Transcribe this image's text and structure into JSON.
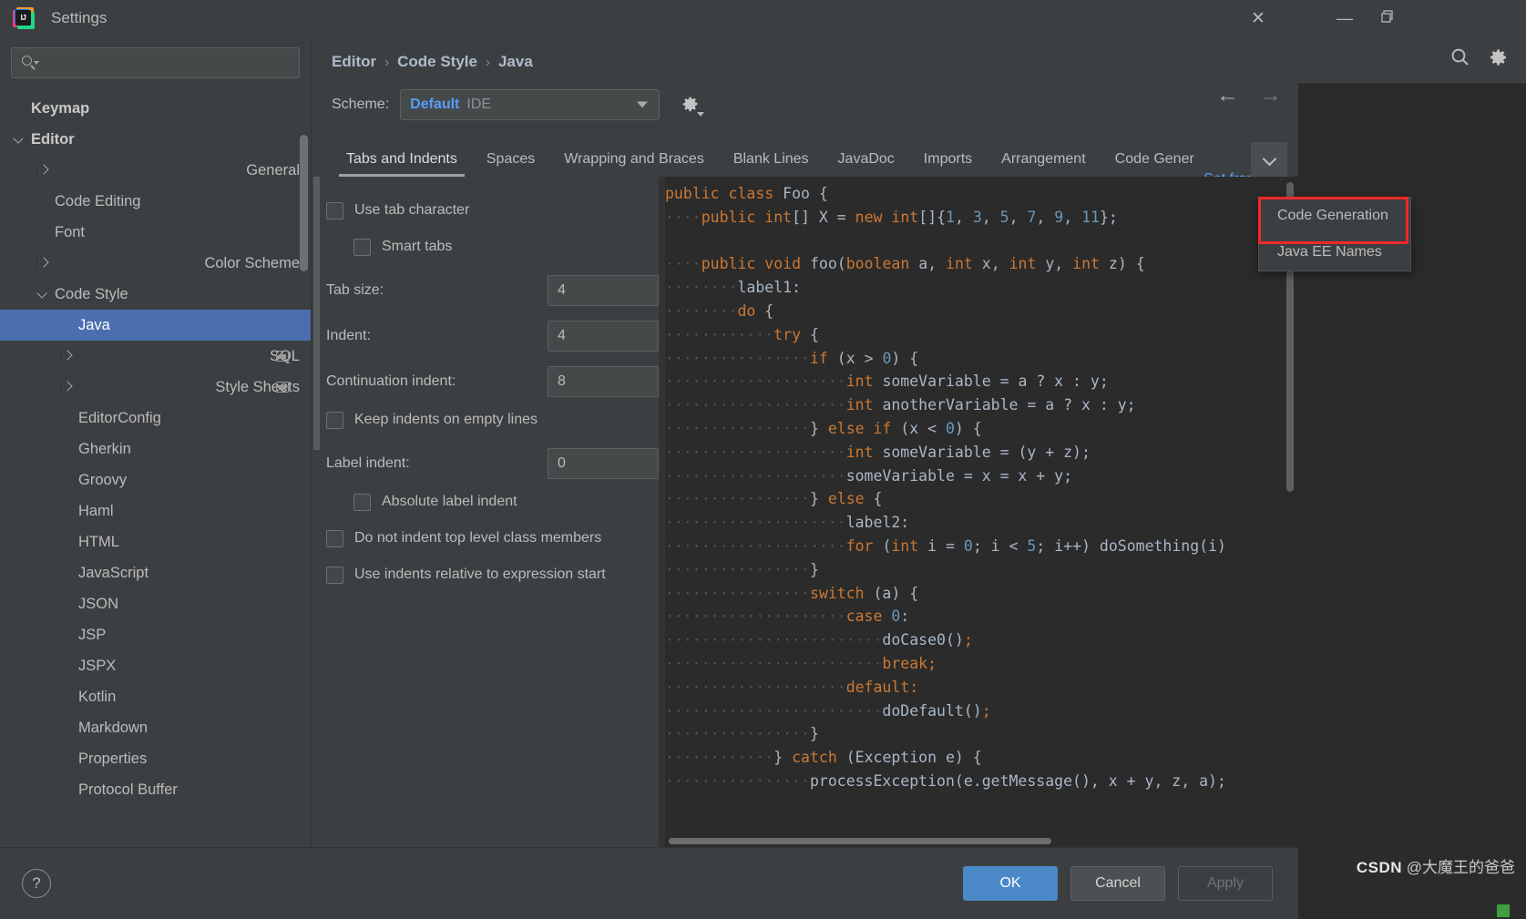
{
  "window": {
    "title": "Settings",
    "app_icon": "intellij-idea-icon",
    "close_label": "✕",
    "minimize_label": "—",
    "restore_label": "❐"
  },
  "ide": {
    "search_icon": "search-icon",
    "settings_icon": "gear-icon"
  },
  "sidebar": {
    "search_placeholder": "",
    "items": [
      {
        "label": "Keymap",
        "indent": 0,
        "chevron": "none",
        "bold": true,
        "selected": false,
        "badge": false
      },
      {
        "label": "Editor",
        "indent": 0,
        "chevron": "down",
        "bold": true,
        "selected": false,
        "badge": false
      },
      {
        "label": "General",
        "indent": 1,
        "chevron": "right",
        "bold": false,
        "selected": false,
        "badge": false
      },
      {
        "label": "Code Editing",
        "indent": 1,
        "chevron": "none",
        "bold": false,
        "selected": false,
        "badge": false
      },
      {
        "label": "Font",
        "indent": 1,
        "chevron": "none",
        "bold": false,
        "selected": false,
        "badge": false
      },
      {
        "label": "Color Scheme",
        "indent": 1,
        "chevron": "right",
        "bold": false,
        "selected": false,
        "badge": false
      },
      {
        "label": "Code Style",
        "indent": 1,
        "chevron": "down",
        "bold": false,
        "selected": false,
        "badge": false
      },
      {
        "label": "Java",
        "indent": 2,
        "chevron": "none",
        "bold": false,
        "selected": true,
        "badge": false
      },
      {
        "label": "SQL",
        "indent": 2,
        "chevron": "right",
        "bold": false,
        "selected": false,
        "badge": true
      },
      {
        "label": "Style Sheets",
        "indent": 2,
        "chevron": "right",
        "bold": false,
        "selected": false,
        "badge": true
      },
      {
        "label": "EditorConfig",
        "indent": 2,
        "chevron": "none",
        "bold": false,
        "selected": false,
        "badge": false
      },
      {
        "label": "Gherkin",
        "indent": 2,
        "chevron": "none",
        "bold": false,
        "selected": false,
        "badge": false
      },
      {
        "label": "Groovy",
        "indent": 2,
        "chevron": "none",
        "bold": false,
        "selected": false,
        "badge": false
      },
      {
        "label": "Haml",
        "indent": 2,
        "chevron": "none",
        "bold": false,
        "selected": false,
        "badge": false
      },
      {
        "label": "HTML",
        "indent": 2,
        "chevron": "none",
        "bold": false,
        "selected": false,
        "badge": false
      },
      {
        "label": "JavaScript",
        "indent": 2,
        "chevron": "none",
        "bold": false,
        "selected": false,
        "badge": false
      },
      {
        "label": "JSON",
        "indent": 2,
        "chevron": "none",
        "bold": false,
        "selected": false,
        "badge": false
      },
      {
        "label": "JSP",
        "indent": 2,
        "chevron": "none",
        "bold": false,
        "selected": false,
        "badge": false
      },
      {
        "label": "JSPX",
        "indent": 2,
        "chevron": "none",
        "bold": false,
        "selected": false,
        "badge": false
      },
      {
        "label": "Kotlin",
        "indent": 2,
        "chevron": "none",
        "bold": false,
        "selected": false,
        "badge": false
      },
      {
        "label": "Markdown",
        "indent": 2,
        "chevron": "none",
        "bold": false,
        "selected": false,
        "badge": false
      },
      {
        "label": "Properties",
        "indent": 2,
        "chevron": "none",
        "bold": false,
        "selected": false,
        "badge": false
      },
      {
        "label": "Protocol Buffer",
        "indent": 2,
        "chevron": "none",
        "bold": false,
        "selected": false,
        "badge": false
      }
    ]
  },
  "breadcrumb": {
    "items": [
      "Editor",
      "Code Style",
      "Java"
    ],
    "separator": "›"
  },
  "nav": {
    "back_icon": "arrow-left-icon",
    "forward_icon": "arrow-right-icon",
    "back_label": "←",
    "forward_label": "→"
  },
  "scheme": {
    "label": "Scheme:",
    "value": "Default",
    "suffix": "IDE",
    "gear_icon": "scheme-gear-icon"
  },
  "links": {
    "set_from": "Set from..."
  },
  "tabs": {
    "items": [
      {
        "label": "Tabs and Indents",
        "active": true
      },
      {
        "label": "Spaces",
        "active": false
      },
      {
        "label": "Wrapping and Braces",
        "active": false
      },
      {
        "label": "Blank Lines",
        "active": false
      },
      {
        "label": "JavaDoc",
        "active": false
      },
      {
        "label": "Imports",
        "active": false
      },
      {
        "label": "Arrangement",
        "active": false
      },
      {
        "label": "Code Gener",
        "active": false
      }
    ],
    "overflow_icon": "chevron-down-icon"
  },
  "overflow_menu": {
    "items": [
      {
        "label": "Code Generation",
        "highlighted": true
      },
      {
        "label": "Java EE Names",
        "highlighted": false
      }
    ],
    "highlight_color": "#ef2929"
  },
  "form": {
    "rows": [
      {
        "type": "checkbox",
        "label": "Use tab character",
        "checked": false,
        "indent": 0
      },
      {
        "type": "checkbox",
        "label": "Smart tabs",
        "checked": false,
        "indent": 1
      },
      {
        "type": "field",
        "label": "Tab size:",
        "value": "4"
      },
      {
        "type": "field",
        "label": "Indent:",
        "value": "4"
      },
      {
        "type": "field",
        "label": "Continuation indent:",
        "value": "8"
      },
      {
        "type": "checkbox",
        "label": "Keep indents on empty lines",
        "checked": false,
        "indent": 0
      },
      {
        "type": "field",
        "label": "Label indent:",
        "value": "0"
      },
      {
        "type": "checkbox",
        "label": "Absolute label indent",
        "checked": false,
        "indent": 1
      },
      {
        "type": "checkbox",
        "label": "Do not indent top level class members",
        "checked": false,
        "indent": 0
      },
      {
        "type": "checkbox",
        "label": "Use indents relative to expression start",
        "checked": false,
        "indent": 0
      }
    ]
  },
  "preview": {
    "language": "Java",
    "lines": [
      [
        {
          "t": "public class ",
          "c": "k"
        },
        {
          "t": "Foo ",
          "c": "p"
        },
        {
          "t": "{",
          "c": "p"
        }
      ],
      [
        {
          "t": "····",
          "c": "dot"
        },
        {
          "t": "public ",
          "c": "k"
        },
        {
          "t": "int",
          "c": "k"
        },
        {
          "t": "[] ",
          "c": "p"
        },
        {
          "t": "X ",
          "c": "p"
        },
        {
          "t": "= ",
          "c": "p"
        },
        {
          "t": "new ",
          "c": "k"
        },
        {
          "t": "int",
          "c": "k"
        },
        {
          "t": "[]{",
          "c": "p"
        },
        {
          "t": "1",
          "c": "n"
        },
        {
          "t": ", ",
          "c": "p"
        },
        {
          "t": "3",
          "c": "n"
        },
        {
          "t": ", ",
          "c": "p"
        },
        {
          "t": "5",
          "c": "n"
        },
        {
          "t": ", ",
          "c": "p"
        },
        {
          "t": "7",
          "c": "n"
        },
        {
          "t": ", ",
          "c": "p"
        },
        {
          "t": "9",
          "c": "n"
        },
        {
          "t": ", ",
          "c": "p"
        },
        {
          "t": "11",
          "c": "n"
        },
        {
          "t": "};",
          "c": "p"
        }
      ],
      [],
      [
        {
          "t": "····",
          "c": "dot"
        },
        {
          "t": "public void ",
          "c": "k"
        },
        {
          "t": "foo(",
          "c": "p"
        },
        {
          "t": "boolean ",
          "c": "k"
        },
        {
          "t": "a, ",
          "c": "p"
        },
        {
          "t": "int ",
          "c": "k"
        },
        {
          "t": "x, ",
          "c": "p"
        },
        {
          "t": "int ",
          "c": "k"
        },
        {
          "t": "y, ",
          "c": "p"
        },
        {
          "t": "int ",
          "c": "k"
        },
        {
          "t": "z) {",
          "c": "p"
        }
      ],
      [
        {
          "t": "········",
          "c": "dot"
        },
        {
          "t": "label1:",
          "c": "p"
        }
      ],
      [
        {
          "t": "········",
          "c": "dot"
        },
        {
          "t": "do ",
          "c": "k"
        },
        {
          "t": "{",
          "c": "p"
        }
      ],
      [
        {
          "t": "············",
          "c": "dot"
        },
        {
          "t": "try ",
          "c": "k"
        },
        {
          "t": "{",
          "c": "p"
        }
      ],
      [
        {
          "t": "················",
          "c": "dot"
        },
        {
          "t": "if ",
          "c": "k"
        },
        {
          "t": "(x > ",
          "c": "p"
        },
        {
          "t": "0",
          "c": "n"
        },
        {
          "t": ") {",
          "c": "p"
        }
      ],
      [
        {
          "t": "····················",
          "c": "dot"
        },
        {
          "t": "int ",
          "c": "k"
        },
        {
          "t": "someVariable = a ? x : y;",
          "c": "p"
        }
      ],
      [
        {
          "t": "····················",
          "c": "dot"
        },
        {
          "t": "int ",
          "c": "k"
        },
        {
          "t": "anotherVariable = a ? x : y;",
          "c": "p"
        }
      ],
      [
        {
          "t": "················",
          "c": "dot"
        },
        {
          "t": "} ",
          "c": "p"
        },
        {
          "t": "else if ",
          "c": "k"
        },
        {
          "t": "(x < ",
          "c": "p"
        },
        {
          "t": "0",
          "c": "n"
        },
        {
          "t": ") {",
          "c": "p"
        }
      ],
      [
        {
          "t": "····················",
          "c": "dot"
        },
        {
          "t": "int ",
          "c": "k"
        },
        {
          "t": "someVariable = (y + z);",
          "c": "p"
        }
      ],
      [
        {
          "t": "····················",
          "c": "dot"
        },
        {
          "t": "someVariable = x = x + y;",
          "c": "p"
        }
      ],
      [
        {
          "t": "················",
          "c": "dot"
        },
        {
          "t": "} ",
          "c": "p"
        },
        {
          "t": "else ",
          "c": "k"
        },
        {
          "t": "{",
          "c": "p"
        }
      ],
      [
        {
          "t": "····················",
          "c": "dot"
        },
        {
          "t": "label2:",
          "c": "p"
        }
      ],
      [
        {
          "t": "····················",
          "c": "dot"
        },
        {
          "t": "for ",
          "c": "k"
        },
        {
          "t": "(",
          "c": "p"
        },
        {
          "t": "int ",
          "c": "k"
        },
        {
          "t": "i = ",
          "c": "p"
        },
        {
          "t": "0",
          "c": "n"
        },
        {
          "t": "; i < ",
          "c": "p"
        },
        {
          "t": "5",
          "c": "n"
        },
        {
          "t": "; i++) doSomething(i)",
          "c": "p"
        }
      ],
      [
        {
          "t": "················",
          "c": "dot"
        },
        {
          "t": "}",
          "c": "p"
        }
      ],
      [
        {
          "t": "················",
          "c": "dot"
        },
        {
          "t": "switch ",
          "c": "k"
        },
        {
          "t": "(a) {",
          "c": "p"
        }
      ],
      [
        {
          "t": "····················",
          "c": "dot"
        },
        {
          "t": "case ",
          "c": "k"
        },
        {
          "t": "0",
          "c": "n"
        },
        {
          "t": ":",
          "c": "p"
        }
      ],
      [
        {
          "t": "························",
          "c": "dot"
        },
        {
          "t": "doCase0()",
          "c": "p"
        },
        {
          "t": ";",
          "c": "s"
        }
      ],
      [
        {
          "t": "························",
          "c": "dot"
        },
        {
          "t": "break;",
          "c": "k"
        }
      ],
      [
        {
          "t": "····················",
          "c": "dot"
        },
        {
          "t": "default:",
          "c": "k"
        }
      ],
      [
        {
          "t": "························",
          "c": "dot"
        },
        {
          "t": "doDefault()",
          "c": "p"
        },
        {
          "t": ";",
          "c": "s"
        }
      ],
      [
        {
          "t": "················",
          "c": "dot"
        },
        {
          "t": "}",
          "c": "p"
        }
      ],
      [
        {
          "t": "············",
          "c": "dot"
        },
        {
          "t": "} ",
          "c": "p"
        },
        {
          "t": "catch ",
          "c": "k"
        },
        {
          "t": "(Exception e) {",
          "c": "p"
        }
      ],
      [
        {
          "t": "················",
          "c": "dot"
        },
        {
          "t": "processException(e.getMessage(), x + y, z, a);",
          "c": "p"
        }
      ]
    ]
  },
  "footer": {
    "help_label": "?",
    "ok_label": "OK",
    "cancel_label": "Cancel",
    "apply_label": "Apply"
  },
  "watermark": {
    "csdn": "CSDN",
    "author": "@大魔王的爸爸"
  }
}
